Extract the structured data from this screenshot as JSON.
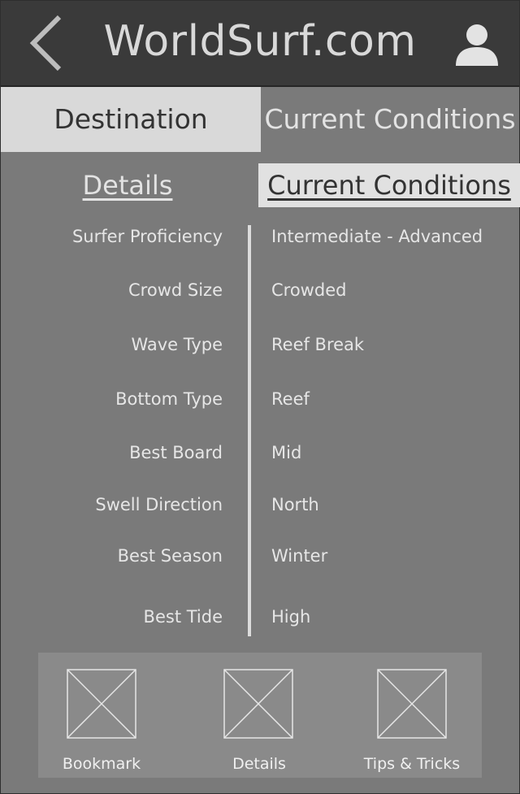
{
  "header": {
    "title": "WorldSurf.com",
    "back_icon": "chevron-left-icon",
    "profile_icon": "user-icon"
  },
  "tabs": [
    {
      "label": "Destination",
      "selected": true
    },
    {
      "label": "Current Conditions",
      "selected": false
    }
  ],
  "subtabs": [
    {
      "label": "Details",
      "selected": false
    },
    {
      "label": "Current Conditions",
      "selected": true
    }
  ],
  "info": [
    {
      "label": "Surfer Proficiency",
      "value": "Intermediate - Advanced"
    },
    {
      "label": "Crowd Size",
      "value": "Crowded"
    },
    {
      "label": "Wave Type",
      "value": "Reef Break"
    },
    {
      "label": "Bottom Type",
      "value": "Reef"
    },
    {
      "label": "Best Board",
      "value": "Mid"
    },
    {
      "label": "Swell Direction",
      "value": "North"
    },
    {
      "label": "Best Season",
      "value": "Winter"
    },
    {
      "label": "Best Tide",
      "value": "High"
    }
  ],
  "actions": [
    {
      "label": "Bookmark",
      "icon": "image-placeholder-icon"
    },
    {
      "label": "Details",
      "icon": "image-placeholder-icon"
    },
    {
      "label": "Tips & Tricks",
      "icon": "image-placeholder-icon"
    }
  ],
  "colors": {
    "header_bg": "#3a3a3a",
    "body_bg": "#7a7a7a",
    "selected_tab_bg": "#d9d9d9",
    "text_light": "#e6e6e6",
    "text_dark": "#333333"
  }
}
